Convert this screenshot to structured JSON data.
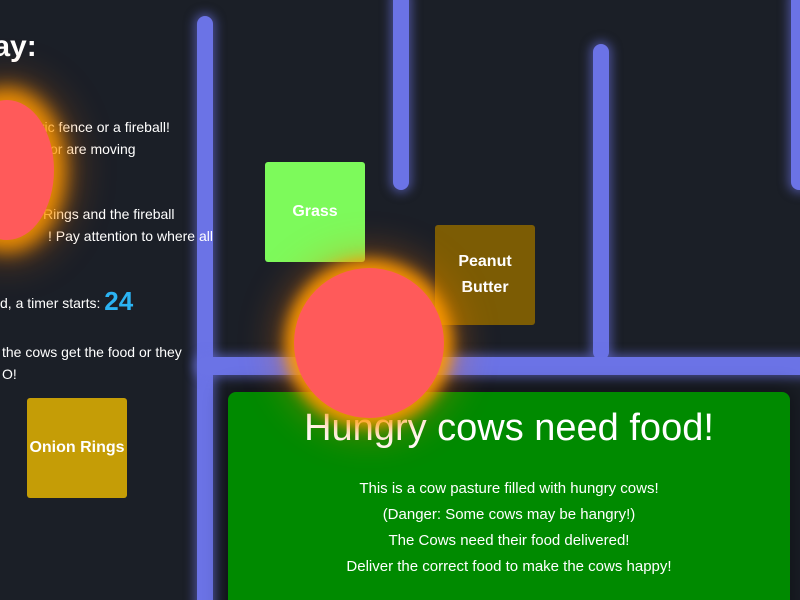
{
  "instructions": {
    "title": "o play:",
    "lines": [
      "tric fence or a fireball!",
      "or are moving",
      "Rings and the fireball",
      "! Pay attention to where all"
    ],
    "timer_prefix": "d, a timer starts:",
    "timer_value": "24",
    "rule_line_1": "the cows get the food or they",
    "rule_line_2": "O!"
  },
  "foods": {
    "grass": "Grass",
    "peanut_butter_line1": "Peanut",
    "peanut_butter_line2": "Butter",
    "onion_rings": "Onion Rings"
  },
  "panel": {
    "heading": "Hungry cows need food!",
    "lines": [
      "This is a cow pasture filled with hungry cows!",
      "(Danger: Some cows may be hangry!)",
      "The Cows need their food delivered!",
      "Deliver the correct food to make the cows happy!"
    ]
  },
  "colors": {
    "background": "#1b1f27",
    "fence": "#6b73e6",
    "grass": "#7dfa5b",
    "peanut_butter": "#7c5c04",
    "onion_rings": "#c59d06",
    "fireball": "#ff5a5a",
    "fireball_glow": "#ff9a00",
    "panel": "#008a00",
    "timer": "#2bb3f3"
  }
}
